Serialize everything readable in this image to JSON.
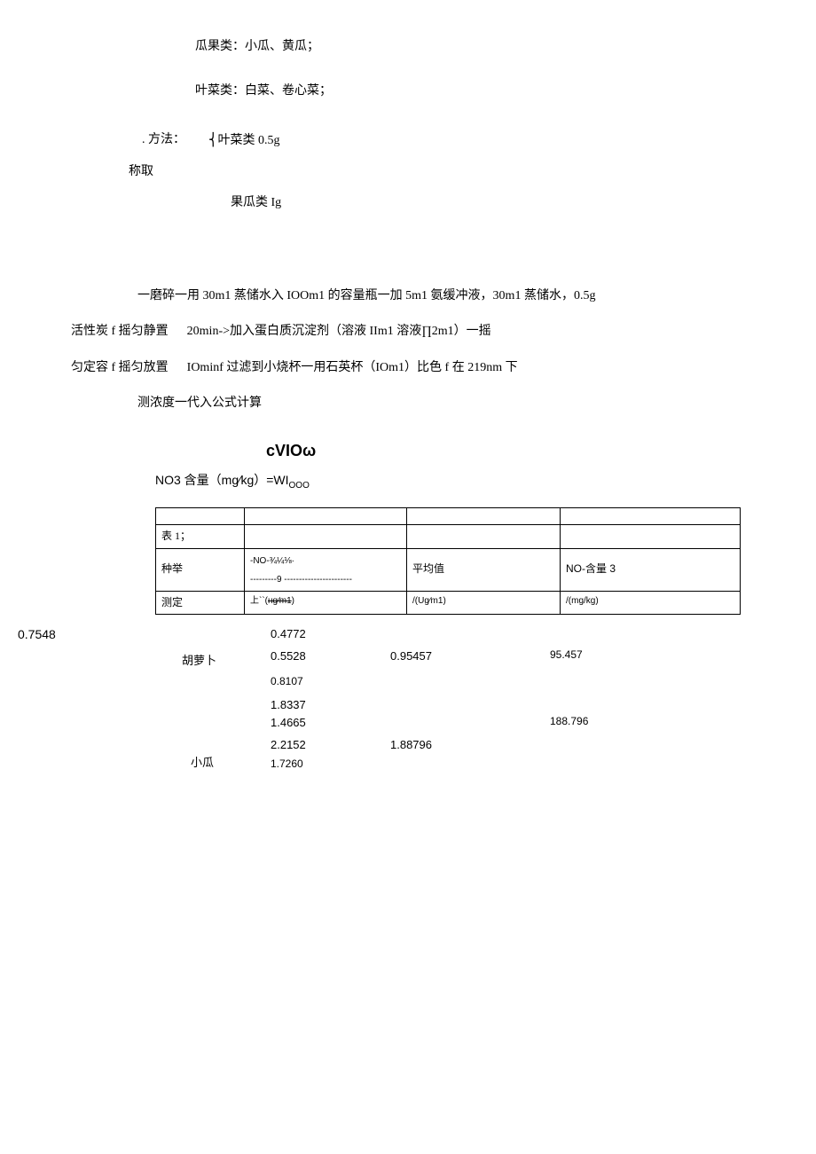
{
  "lines": {
    "melon_class": "瓜果类：小瓜、黄瓜；",
    "leaf_class": "叶菜类：白菜、卷心菜；",
    "method_label": ". 方法：",
    "leaf_amt": "⎨叶菜类 0.5g",
    "weigh": "称取",
    "fruit_amt": "果瓜类 Ig",
    "step1": "一磨碎一用 30m1 蒸储水入 IOOm1 的容量瓶一加 5m1 氨缓冲液，30m1 蒸储水，0.5g",
    "step2": "活性炭 f 摇匀静置      20min->加入蛋白质沉淀剂（溶液 IIm1 溶液∏2m1）一摇",
    "step3": "匀定容 f 摇匀放置      IOminf 过滤到小烧杯一用石英杯（IOm1）比色 f 在 219nm 下",
    "step4": "测浓度一代入公式计算",
    "cviow": "cVΙOω",
    "no3_formula_a": "NO3 含量（mg∕kg）=WI",
    "no3_formula_sub": "OOO"
  },
  "table": {
    "title": "表 1；",
    "col1": "种举",
    "col2a": "-NO-¾¼⅛·",
    "col2b": "---------9 -----------------------",
    "col3": "平均值",
    "col4": "NO-含量 3",
    "r2c1": "测定",
    "r2c2a": "上``(",
    "r2c2b": "нg∕m1",
    "r2c2c": ")",
    "r2c3": "/(Ug∕m1)",
    "r2c4": "/(mg/kg)"
  },
  "side_value": "0.7548",
  "chart_data": {
    "type": "table",
    "left_col_label": "0.7548",
    "rows": [
      {
        "sample": "胡萝卜",
        "readings": [
          "0.4772",
          "0.5528",
          "0.8107"
        ],
        "average": "0.95457",
        "content": "95.457"
      },
      {
        "sample": "小瓜",
        "readings": [
          "1.8337",
          "1.4665",
          "2.2152",
          "1.7260"
        ],
        "average": "1.88796",
        "content": "188.796"
      }
    ]
  }
}
